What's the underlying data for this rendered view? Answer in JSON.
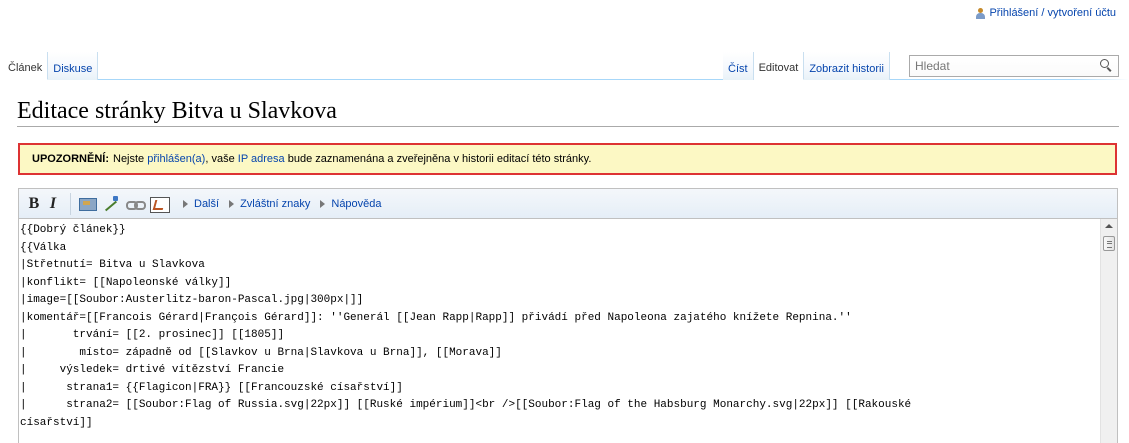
{
  "personal": {
    "login_label": "Přihlášení / vytvoření účtu",
    "icon": "user-icon"
  },
  "tabs": {
    "left": [
      {
        "label": "Článek"
      },
      {
        "label": "Diskuse"
      }
    ],
    "right": [
      {
        "label": "Číst"
      },
      {
        "label": "Editovat"
      },
      {
        "label": "Zobrazit historii"
      }
    ]
  },
  "search": {
    "placeholder": "Hledat",
    "icon": "search-icon"
  },
  "page_title": "Editace stránky Bitva u Slavkova",
  "warning": {
    "label": "UPOZORNĚNÍ:",
    "text_1": "Nejste",
    "link_1": "přihlášen(a)",
    "text_2": ", vaše",
    "link_2": "IP adresa",
    "text_3": "bude zaznamenána a zveřejněna v historii editací této stránky."
  },
  "toolbar": {
    "bold": "B",
    "italic": "I",
    "icons": [
      "signature-icon",
      "pen-icon",
      "link-icon",
      "image-icon"
    ],
    "menus": [
      {
        "label": "Další"
      },
      {
        "label": "Zvláštní znaky"
      },
      {
        "label": "Nápověda"
      }
    ]
  },
  "wikitext": "{{Dobrý článek}}\n{{Válka\n|Střetnutí= Bitva u Slavkova\n|konflikt= [[Napoleonské války]]\n|image=[[Soubor:Austerlitz-baron-Pascal.jpg|300px|]]\n|komentář=[[Francois Gérard|François Gérard]]: ''Generál [[Jean Rapp|Rapp]] přivádí před Napoleona zajatého knížete Repnina.''\n|       trvání= [[2. prosinec]] [[1805]]\n|        místo= západně od [[Slavkov u Brna|Slavkova u Brna]], [[Morava]]\n|     výsledek= drtivé vítězství Francie\n|      strana1= {{Flagicon|FRA}} [[Francouzské císařství]]\n|      strana2= [[Soubor:Flag of Russia.svg|22px]] [[Ruské impérium]]<br />[[Soubor:Flag of the Habsburg Monarchy.svg|22px]] [[Rakouské\ncísařství]]"
}
